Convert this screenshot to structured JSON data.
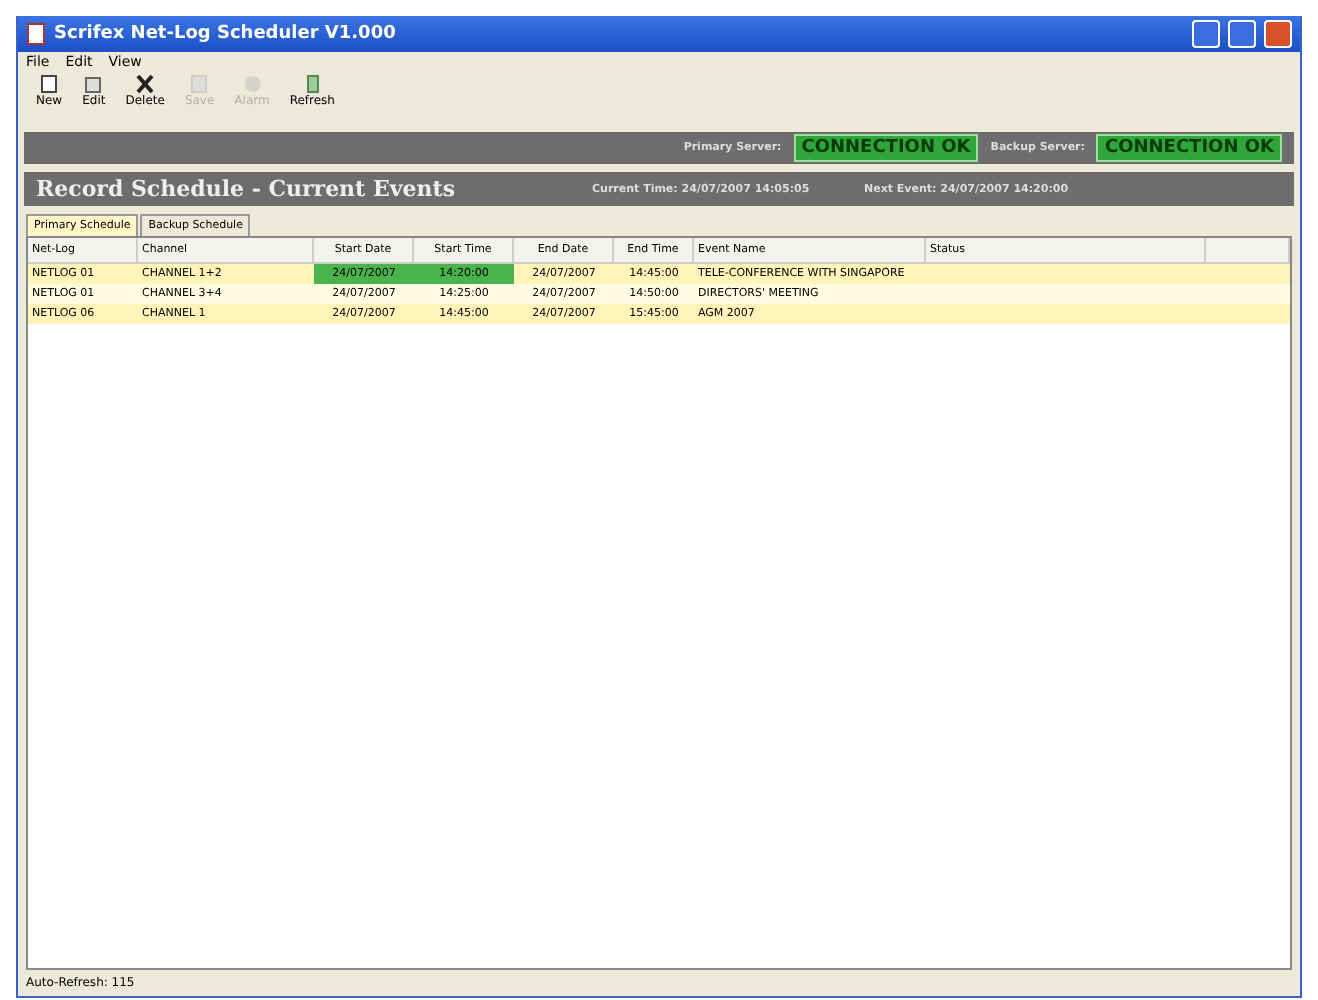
{
  "window": {
    "title": "Scrifex Net-Log Scheduler V1.000"
  },
  "menu": [
    "File",
    "Edit",
    "View"
  ],
  "toolbar": [
    {
      "label": "New",
      "disabled": false
    },
    {
      "label": "Edit",
      "disabled": false
    },
    {
      "label": "Delete",
      "disabled": false
    },
    {
      "label": "Save",
      "disabled": true
    },
    {
      "label": "Alarm",
      "disabled": true
    },
    {
      "label": "Refresh",
      "disabled": false
    }
  ],
  "servers": [
    {
      "label": "Primary Server:",
      "status": "CONNECTION OK"
    },
    {
      "label": "Backup Server:",
      "status": "CONNECTION OK"
    }
  ],
  "header": {
    "title": "Record Schedule - Current Events",
    "current_time": "Current Time: 24/07/2007 14:05:05",
    "next_event": "Next Event: 24/07/2007 14:20:00"
  },
  "tabs": [
    {
      "label": "Primary Schedule",
      "selected": true
    },
    {
      "label": "Backup Schedule",
      "selected": false
    }
  ],
  "table": {
    "columns": [
      "Net-Log",
      "Channel",
      "Start Date",
      "Start Time",
      "End Date",
      "End Time",
      "Event Name",
      "Status"
    ],
    "rows": [
      {
        "cells": [
          "NETLOG 01",
          "CHANNEL 1+2",
          "24/07/2007",
          "14:20:00",
          "24/07/2007",
          "14:45:00",
          "TELE-CONFERENCE WITH SINGAPORE",
          ""
        ],
        "next": true
      },
      {
        "cells": [
          "NETLOG 01",
          "CHANNEL 3+4",
          "24/07/2007",
          "14:25:00",
          "24/07/2007",
          "14:50:00",
          "DIRECTORS' MEETING",
          ""
        ],
        "next": false
      },
      {
        "cells": [
          "NETLOG 06",
          "CHANNEL 1",
          "24/07/2007",
          "14:45:00",
          "24/07/2007",
          "15:45:00",
          "AGM 2007",
          ""
        ],
        "next": false
      }
    ]
  },
  "status_bar": "Auto-Refresh: 115"
}
